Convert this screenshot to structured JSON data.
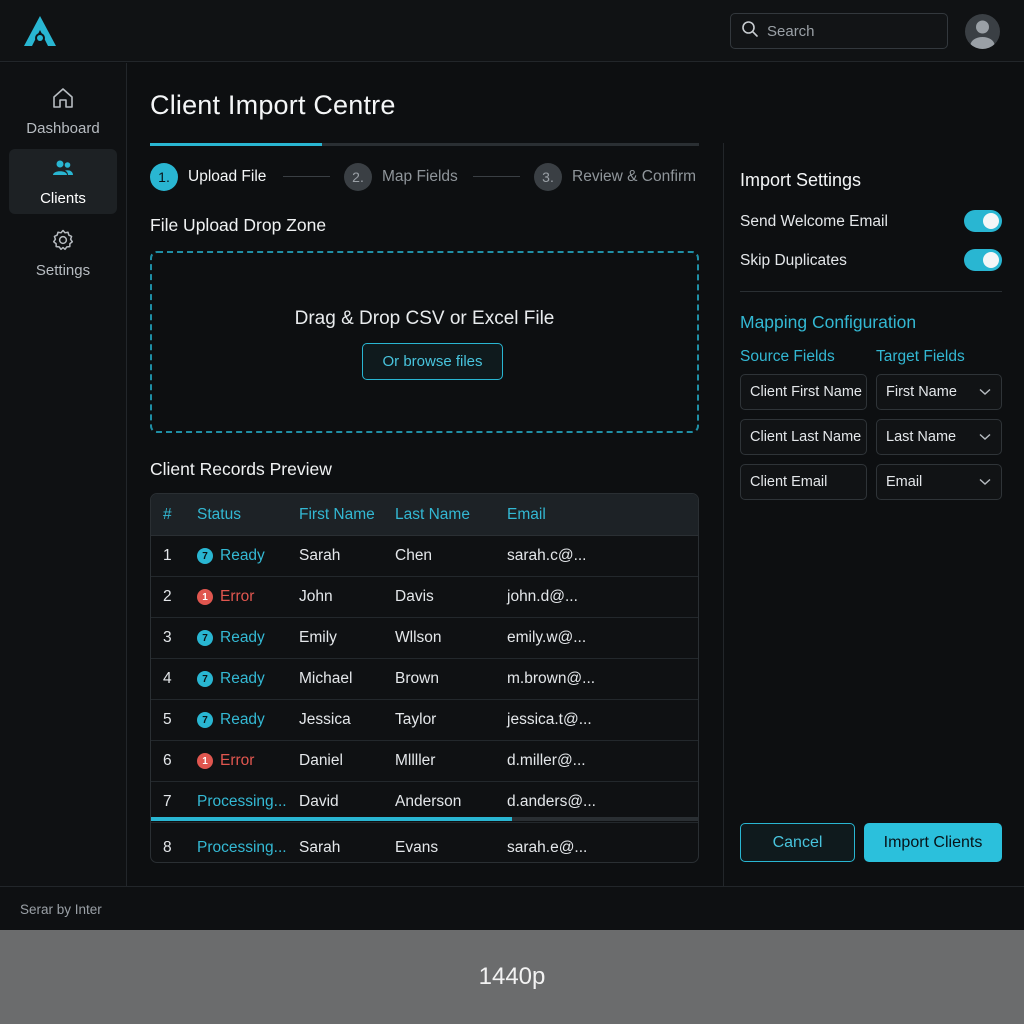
{
  "header": {
    "logo_icon": "brand-logo",
    "search_placeholder": "Search",
    "avatar_icon": "user-avatar-icon"
  },
  "sidebar": {
    "items": [
      {
        "label": "Dashboard",
        "icon": "home-icon",
        "active": false
      },
      {
        "label": "Clients",
        "icon": "users-icon",
        "active": true
      },
      {
        "label": "Settings",
        "icon": "gear-icon",
        "active": false
      }
    ]
  },
  "main": {
    "title": "Client Import Centre",
    "steps": [
      {
        "num": "1.",
        "label": "Upload File",
        "active": true
      },
      {
        "num": "2.",
        "label": "Map Fields",
        "active": false
      },
      {
        "num": "3.",
        "label": "Review & Confirm",
        "active": false
      }
    ],
    "upload_title": "File Upload Drop Zone",
    "dropzone_text": "Drag & Drop CSV or Excel File",
    "browse_label": "Or browse files",
    "preview_title": "Client Records Preview",
    "table": {
      "columns": [
        "#",
        "Status",
        "First Name",
        "Last Name",
        "Email"
      ],
      "rows": [
        {
          "num": "1",
          "badge": "7",
          "status": "Ready",
          "status_type": "ready",
          "first": "Sarah",
          "last": "Chen",
          "email": "sarah.c@..."
        },
        {
          "num": "2",
          "badge": "1",
          "status": "Error",
          "status_type": "error",
          "first": "John",
          "last": "Davis",
          "email": "john.d@..."
        },
        {
          "num": "3",
          "badge": "7",
          "status": "Ready",
          "status_type": "ready",
          "first": "Emily",
          "last": "Wllson",
          "email": "emily.w@..."
        },
        {
          "num": "4",
          "badge": "7",
          "status": "Ready",
          "status_type": "ready",
          "first": "Michael",
          "last": "Brown",
          "email": "m.brown@..."
        },
        {
          "num": "5",
          "badge": "7",
          "status": "Ready",
          "status_type": "ready",
          "first": "Jessica",
          "last": "Taylor",
          "email": "jessica.t@..."
        },
        {
          "num": "6",
          "badge": "1",
          "status": "Error",
          "status_type": "error",
          "first": "Daniel",
          "last": "Mllller",
          "email": "d.miller@..."
        },
        {
          "num": "7",
          "badge": "",
          "status": "Processing...",
          "status_type": "processing",
          "first": "David",
          "last": "Anderson",
          "email": "d.anders@..."
        },
        {
          "num": "8",
          "badge": "",
          "status": "Processing...",
          "status_type": "processing",
          "first": "Sarah",
          "last": "Evans",
          "email": "sarah.e@..."
        }
      ],
      "progress_fraction": 0.66
    }
  },
  "settings": {
    "title": "Import Settings",
    "toggles": [
      {
        "label": "Send Welcome Email",
        "on": true
      },
      {
        "label": "Skip Duplicates",
        "on": true
      }
    ],
    "mapping_title": "Mapping Configuration",
    "source_head": "Source Fields",
    "target_head": "Target Fields",
    "mappings": [
      {
        "source": "Client First Name",
        "target": "First Name"
      },
      {
        "source": "Client Last Name",
        "target": "Last Name"
      },
      {
        "source": "Client Email",
        "target": "Email"
      }
    ],
    "cancel_label": "Cancel",
    "import_label": "Import Clients"
  },
  "footer": {
    "text": "Serar by Inter"
  },
  "caption": {
    "text": "1440p"
  },
  "colors": {
    "accent": "#29b6d2",
    "error": "#e0564f",
    "background": "#0d0f11"
  }
}
